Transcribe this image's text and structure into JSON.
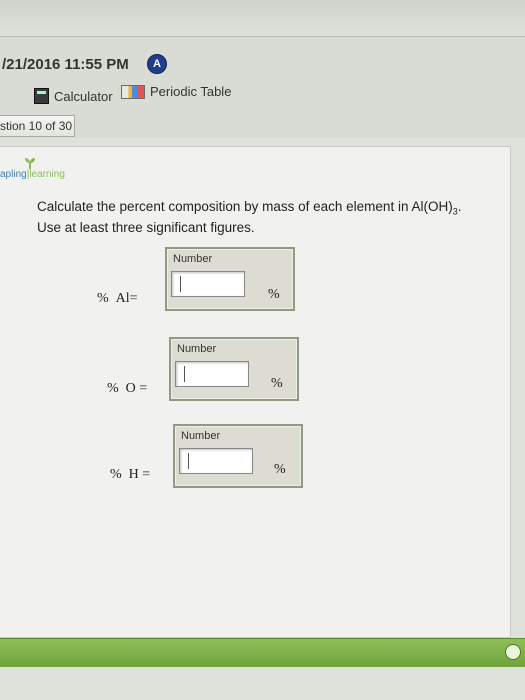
{
  "header": {
    "timestamp": "/21/2016 11:55 PM",
    "badge": "A"
  },
  "tools": {
    "calculator": "Calculator",
    "periodic_table": "Periodic Table"
  },
  "question_nav": {
    "text": "stion 10 of 30"
  },
  "logo": {
    "part1": "apling",
    "part2": "learning"
  },
  "question": {
    "line1": "Calculate the percent composition by mass of each element in Al(OH)",
    "sub": "3",
    "end": ".",
    "line2": "Use at least three significant figures."
  },
  "answers": [
    {
      "label_pct": "%",
      "element": "Al",
      "eq": "=",
      "box_label": "Number",
      "value": "",
      "unit": "%"
    },
    {
      "label_pct": "%",
      "element": "O",
      "eq": "=",
      "box_label": "Number",
      "value": "",
      "unit": "%"
    },
    {
      "label_pct": "%",
      "element": "H",
      "eq": "=",
      "box_label": "Number",
      "value": "",
      "unit": "%"
    }
  ]
}
